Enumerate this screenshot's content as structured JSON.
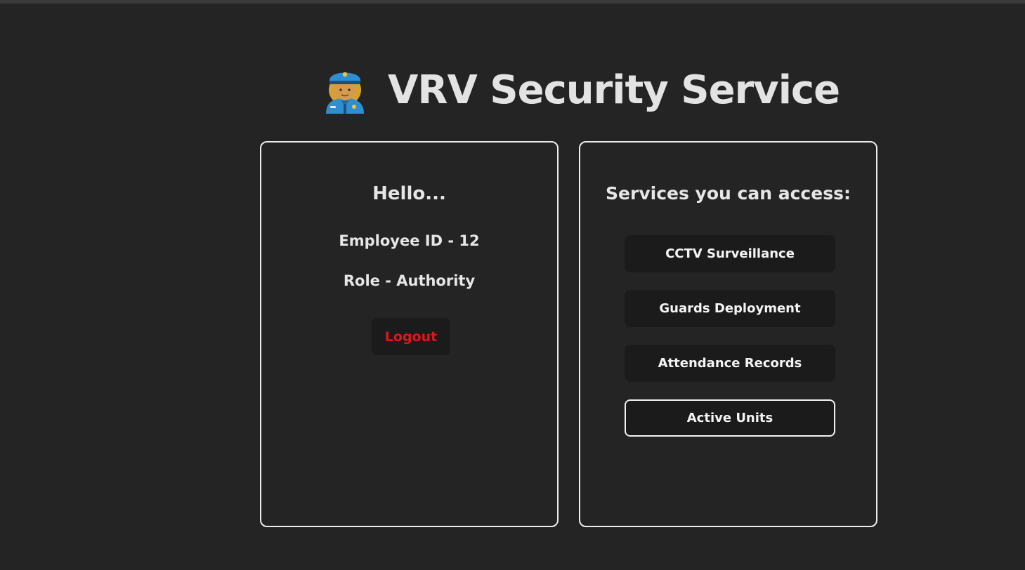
{
  "header": {
    "title": "VRV Security Service",
    "icon": "police-officer-icon"
  },
  "profile": {
    "greeting": "Hello...",
    "employee_id": "Employee ID - 12",
    "role": "Role - Authority",
    "logout_label": "Logout",
    "logout_color": "#e0161c"
  },
  "services": {
    "title": "Services you can access:",
    "items": [
      {
        "label": "CCTV Surveillance",
        "active": false
      },
      {
        "label": "Guards Deployment",
        "active": false
      },
      {
        "label": "Attendance Records",
        "active": false
      },
      {
        "label": "Active Units",
        "active": true
      }
    ]
  },
  "colors": {
    "background": "#242424",
    "button": "#1b1b1b",
    "border": "#ececec",
    "text": "#e6e6e6"
  }
}
